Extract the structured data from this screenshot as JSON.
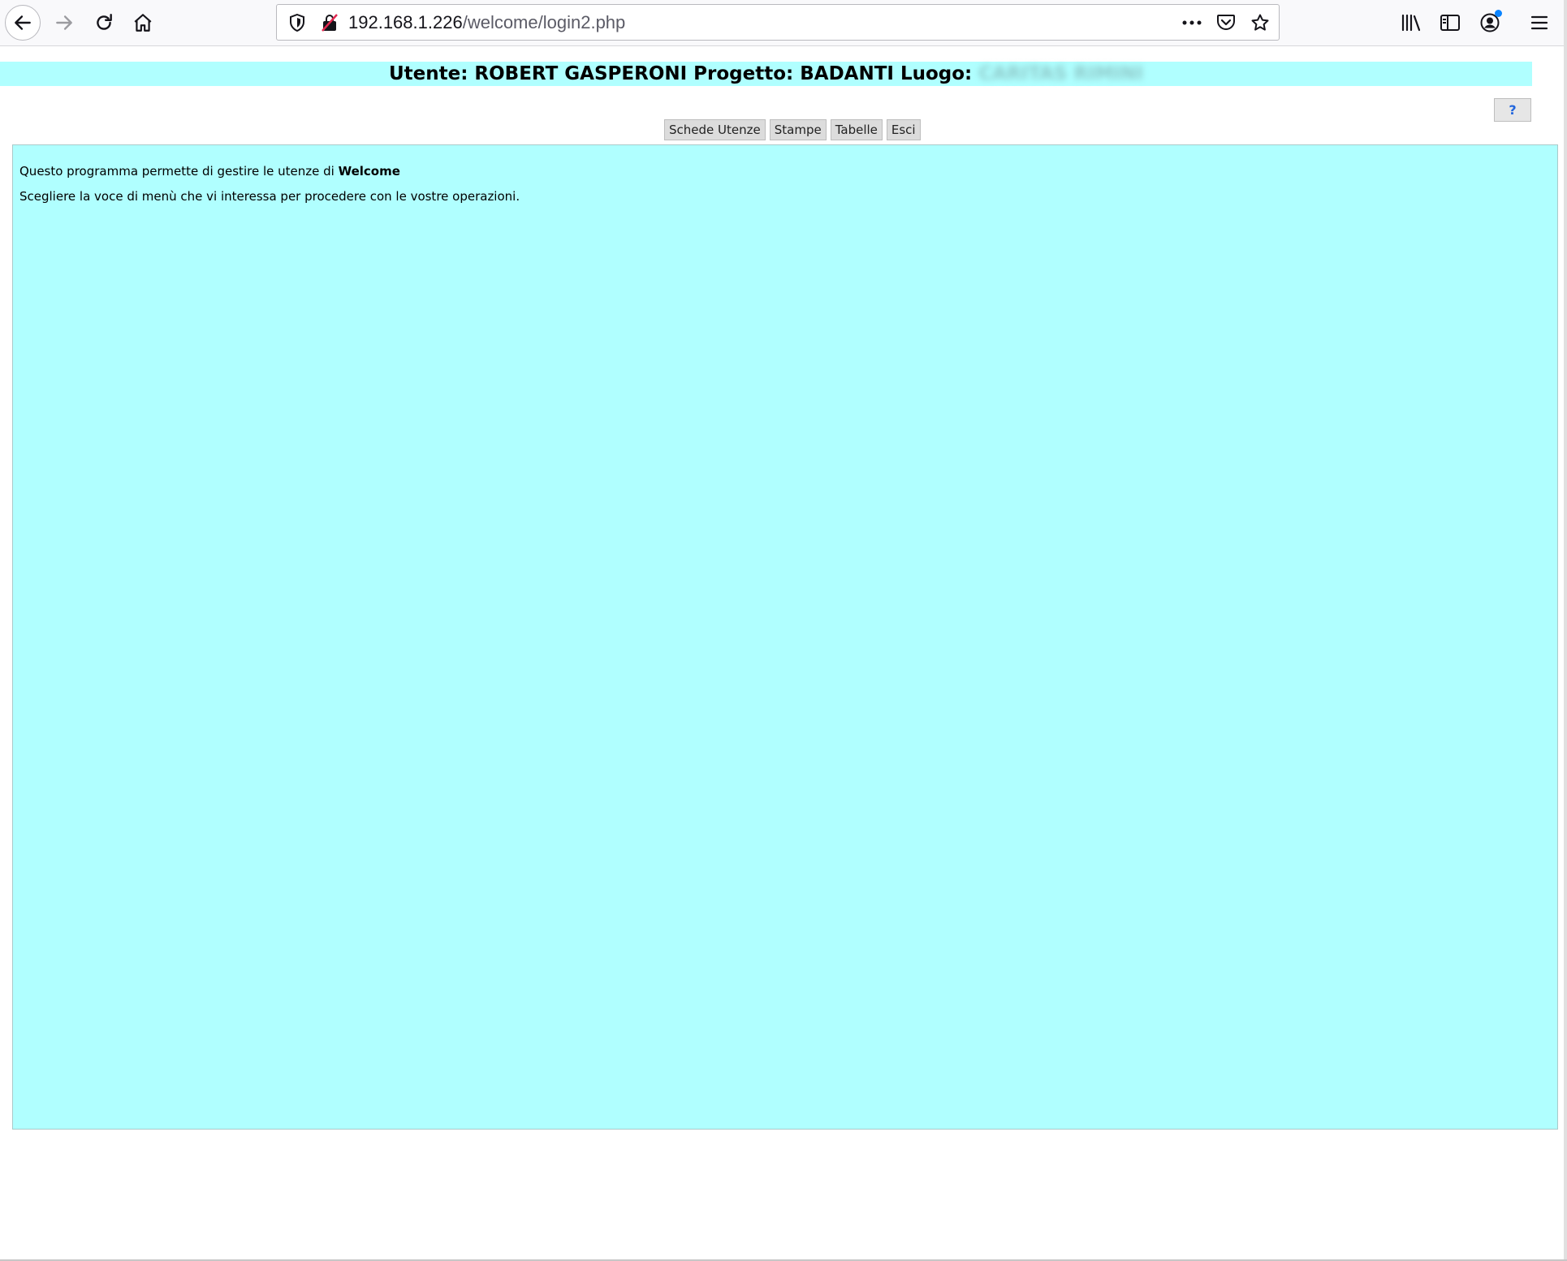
{
  "browser": {
    "url_host": "192.168.1.226",
    "url_path": "/welcome/login2.php"
  },
  "header": {
    "prefix": "Utente: ROBERT GASPERONI Progetto: BADANTI Luogo:",
    "luogo_redacted": "CARITAS RIMINI"
  },
  "help_button": {
    "label": "?"
  },
  "menu": {
    "items": [
      {
        "label": "Schede Utenze"
      },
      {
        "label": "Stampe"
      },
      {
        "label": "Tabelle"
      },
      {
        "label": "Esci"
      }
    ]
  },
  "main": {
    "intro_text": "Questo programma permette di gestire le utenze di",
    "intro_bold": "Welcome",
    "instruction": "Scegliere la voce di menù che vi interessa per procedere con le vostre operazioni."
  },
  "colors": {
    "page_band": "#b0ffff",
    "help_icon": "#2266dd"
  },
  "icons": [
    "back-icon",
    "forward-icon",
    "reload-icon",
    "home-icon",
    "tracking-shield-icon",
    "insecure-lock-icon",
    "more-actions-icon",
    "pocket-icon",
    "bookmark-star-icon",
    "library-icon",
    "sidebar-icon",
    "account-icon",
    "hamburger-menu-icon"
  ]
}
